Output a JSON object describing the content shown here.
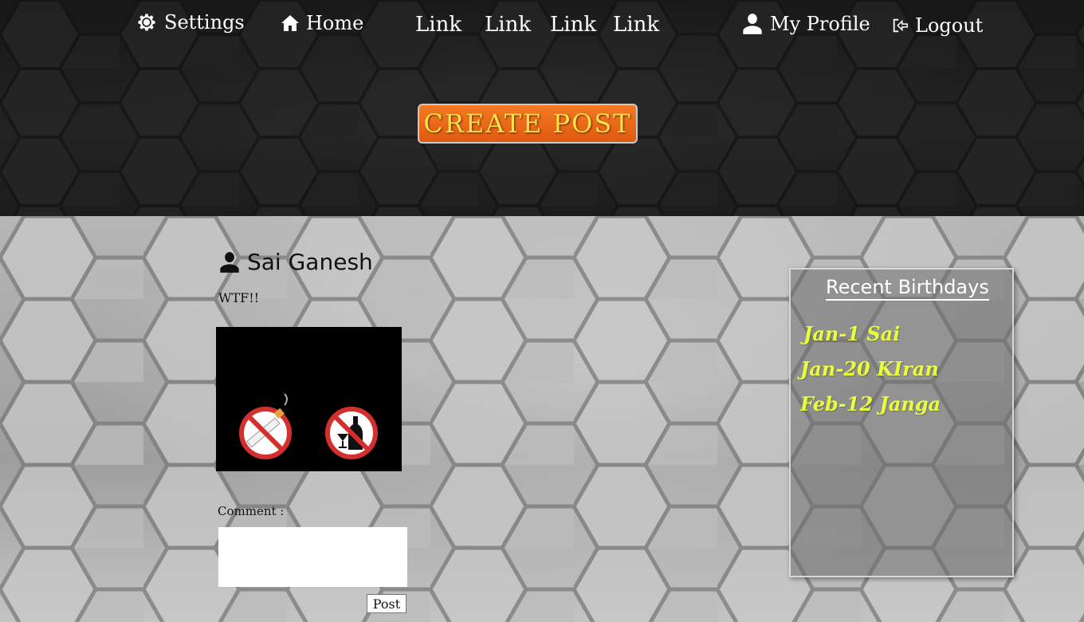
{
  "nav": {
    "settings_label": "Settings",
    "home_label": "Home",
    "links": [
      "Link",
      "Link",
      "Link",
      "Link"
    ],
    "profile_label": "My Profile",
    "logout_label": "Logout",
    "icons": {
      "settings": "gear-icon",
      "home": "home-icon",
      "profile": "user-icon",
      "logout": "logout-icon"
    }
  },
  "create_post": {
    "label": "CREATE POST",
    "colors": {
      "background": "#e86a16",
      "text": "#ffe14a"
    }
  },
  "post": {
    "author": "Sai Ganesh",
    "author_icon": "user-icon",
    "text": "WTF!!",
    "image_icons": [
      "no-smoking-icon",
      "no-alcohol-icon"
    ],
    "comment_label": "Comment :",
    "comment_value": "",
    "post_button_label": "Post"
  },
  "birthdays": {
    "title": "Recent Birthdays",
    "items": [
      "Jan-1 Sai",
      "Jan-20 KIran",
      "Feb-12 Janga"
    ],
    "item_color": "#e8ff3a"
  }
}
